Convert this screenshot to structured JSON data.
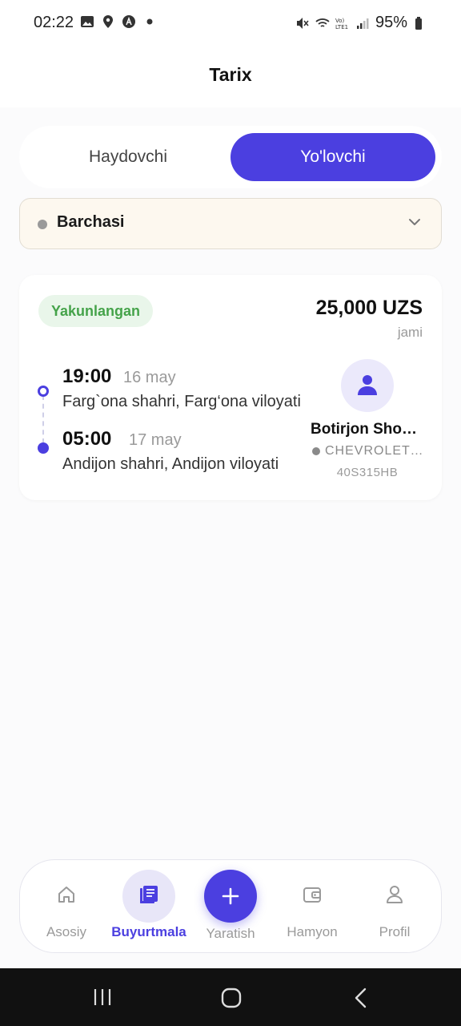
{
  "status_bar": {
    "time": "02:22",
    "battery": "95%",
    "icons": [
      "image-icon",
      "location-icon",
      "app-icon",
      "dot-icon",
      "mute-icon",
      "wifi-icon",
      "lte-icon",
      "signal-icon",
      "battery-icon"
    ]
  },
  "header": {
    "title": "Tarix"
  },
  "tabs": [
    {
      "label": "Haydovchi",
      "active": false
    },
    {
      "label": "Yo'lovchi",
      "active": true
    }
  ],
  "filter": {
    "label": "Barchasi",
    "icon": "chevron-down-icon"
  },
  "order": {
    "status": "Yakunlangan",
    "price": "25,000 UZS",
    "price_sub": "jami",
    "departure": {
      "time": "19:00",
      "date": "16 may",
      "address": "Farg`ona shahri, Farg‘ona viloyati"
    },
    "arrival": {
      "time": "05:00",
      "date": "17 may",
      "address": "Andijon shahri, Andijon viloyati"
    },
    "driver": {
      "name": "Botirjon Shokirov",
      "car": "CHEVROLET COBALT",
      "plate": "40S315HB"
    }
  },
  "bottom_nav": [
    {
      "label": "Asosiy",
      "icon": "home-icon",
      "active": false
    },
    {
      "label": "Buyurtmala",
      "icon": "orders-icon",
      "active": true
    },
    {
      "label": "Yaratish",
      "icon": "plus-icon",
      "active": false
    },
    {
      "label": "Hamyon",
      "icon": "wallet-icon",
      "active": false
    },
    {
      "label": "Profil",
      "icon": "profile-icon",
      "active": false
    }
  ],
  "colors": {
    "accent": "#4b3fe0",
    "status_green": "#45a34a",
    "filter_bg": "#fdf8ef"
  }
}
